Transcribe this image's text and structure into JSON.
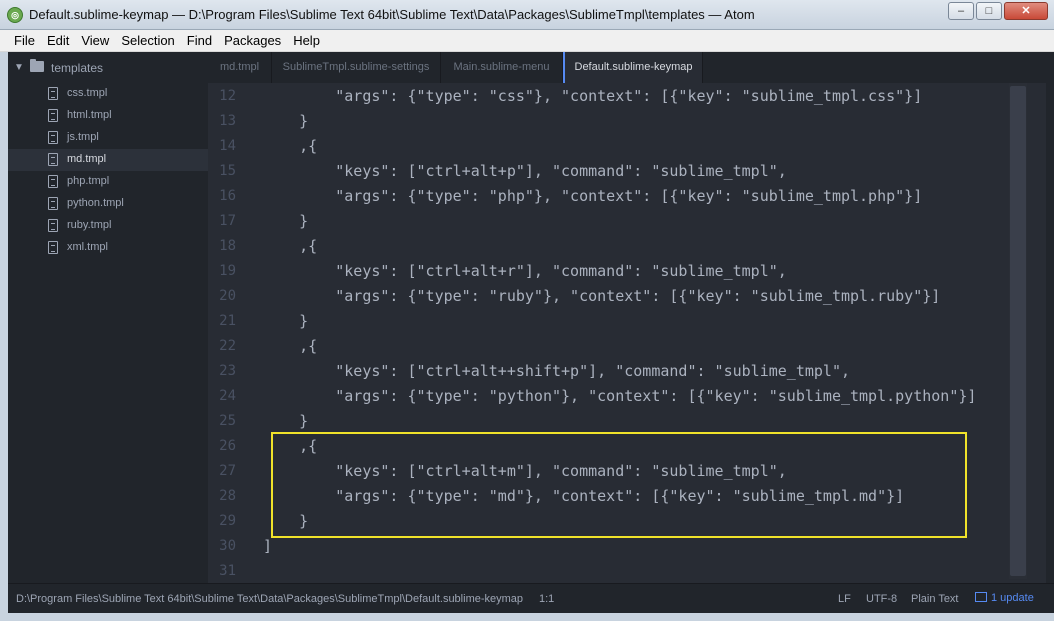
{
  "window": {
    "title": "Default.sublime-keymap — D:\\Program Files\\Sublime Text 64bit\\Sublime Text\\Data\\Packages\\SublimeTmpl\\templates — Atom",
    "icon": "atom-app-icon",
    "controls": {
      "minimize": "–",
      "maximize": "□",
      "close": "✕"
    }
  },
  "menu": [
    "File",
    "Edit",
    "View",
    "Selection",
    "Find",
    "Packages",
    "Help"
  ],
  "tree": {
    "root": "templates",
    "files": [
      "css.tmpl",
      "html.tmpl",
      "js.tmpl",
      "md.tmpl",
      "php.tmpl",
      "python.tmpl",
      "ruby.tmpl",
      "xml.tmpl"
    ],
    "selected": "md.tmpl"
  },
  "tabs": [
    "md.tmpl",
    "SublimeTmpl.sublime-settings",
    "Main.sublime-menu",
    "Default.sublime-keymap"
  ],
  "active_tab": "Default.sublime-keymap",
  "editor": {
    "line_numbers": [
      "12",
      "13",
      "14",
      "15",
      "16",
      "17",
      "18",
      "19",
      "20",
      "21",
      "22",
      "23",
      "24",
      "25",
      "26",
      "27",
      "28",
      "29",
      "30",
      "31"
    ],
    "lines": [
      "        \"args\": {\"type\": \"css\"}, \"context\": [{\"key\": \"sublime_tmpl.css\"}]",
      "    }",
      "    ,{",
      "        \"keys\": [\"ctrl+alt+p\"], \"command\": \"sublime_tmpl\",",
      "        \"args\": {\"type\": \"php\"}, \"context\": [{\"key\": \"sublime_tmpl.php\"}]",
      "    }",
      "    ,{",
      "        \"keys\": [\"ctrl+alt+r\"], \"command\": \"sublime_tmpl\",",
      "        \"args\": {\"type\": \"ruby\"}, \"context\": [{\"key\": \"sublime_tmpl.ruby\"}]",
      "    }",
      "    ,{",
      "        \"keys\": [\"ctrl+alt++shift+p\"], \"command\": \"sublime_tmpl\",",
      "        \"args\": {\"type\": \"python\"}, \"context\": [{\"key\": \"sublime_tmpl.python\"}]",
      "    }",
      "    ,{",
      "        \"keys\": [\"ctrl+alt+m\"], \"command\": \"sublime_tmpl\",",
      "        \"args\": {\"type\": \"md\"}, \"context\": [{\"key\": \"sublime_tmpl.md\"}]",
      "    }",
      "]",
      ""
    ],
    "highlight_color": "#f0e22a"
  },
  "status": {
    "path": "D:\\Program Files\\Sublime Text 64bit\\Sublime Text\\Data\\Packages\\SublimeTmpl\\Default.sublime-keymap",
    "cursor": "1:1",
    "line_ending": "LF",
    "encoding": "UTF-8",
    "grammar": "Plain Text",
    "update": "1 update"
  },
  "colors": {
    "accent": "#568af2",
    "background": "#282c34",
    "sidebar": "#21252b"
  }
}
